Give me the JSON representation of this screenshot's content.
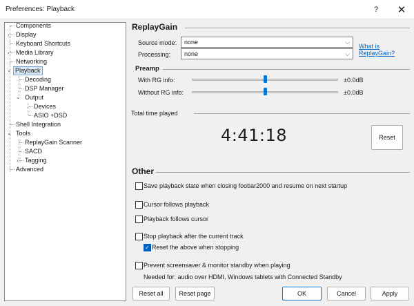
{
  "window": {
    "title": "Preferences: Playback",
    "help_glyph": "?",
    "close_glyph": "✕"
  },
  "tree": {
    "items": [
      {
        "label": "Components"
      },
      {
        "label": "Display",
        "expander": "›"
      },
      {
        "label": "Keyboard Shortcuts"
      },
      {
        "label": "Media Library",
        "expander": "›"
      },
      {
        "label": "Networking"
      },
      {
        "label": "Playback",
        "expander": "⌄"
      },
      {
        "label": "Decoding"
      },
      {
        "label": "DSP Manager"
      },
      {
        "label": "Output",
        "expander": "⌄"
      },
      {
        "label": "Devices"
      },
      {
        "label": "ASIO +DSD"
      },
      {
        "label": "Shell Integration"
      },
      {
        "label": "Tools",
        "expander": "⌄"
      },
      {
        "label": "ReplayGain Scanner"
      },
      {
        "label": "SACD"
      },
      {
        "label": "Tagging",
        "expander": "›"
      },
      {
        "label": "Advanced"
      }
    ]
  },
  "replaygain": {
    "title": "ReplayGain",
    "source_mode_label": "Source mode:",
    "source_mode_value": "none",
    "processing_label": "Processing:",
    "processing_value": "none",
    "link_line1": "What is",
    "link_line2": "ReplayGain?"
  },
  "preamp": {
    "title": "Preamp",
    "with_rg_label": "With RG info:",
    "with_rg_value": "±0.0dB",
    "with_rg_level": 0.5,
    "without_rg_label": "Without RG info:",
    "without_rg_value": "±0.0dB",
    "without_rg_level": 0.5
  },
  "total_time": {
    "label": "Total time played",
    "value": "4:41:18",
    "reset_label": "Reset"
  },
  "other": {
    "title": "Other",
    "options": [
      {
        "label": "Save playback state when closing foobar2000 and resume on next startup",
        "checked": false
      },
      {
        "label": "Cursor follows playback",
        "checked": false
      },
      {
        "label": "Playback follows cursor",
        "checked": false
      },
      {
        "label": "Stop playback after the current track",
        "checked": false
      },
      {
        "label": "Reset the above when stopping",
        "checked": true
      },
      {
        "label": "Prevent screensaver & monitor standby when playing",
        "checked": false
      }
    ],
    "note": "Needed for: audio over HDMI, Windows tablets with Connected Standby"
  },
  "buttons": {
    "reset_all": "Reset all",
    "reset_page": "Reset page",
    "ok": "OK",
    "cancel": "Cancel",
    "apply": "Apply"
  },
  "colors": {
    "accent": "#0078d7",
    "link": "#0066cc",
    "selection": "#dbe9f7"
  }
}
